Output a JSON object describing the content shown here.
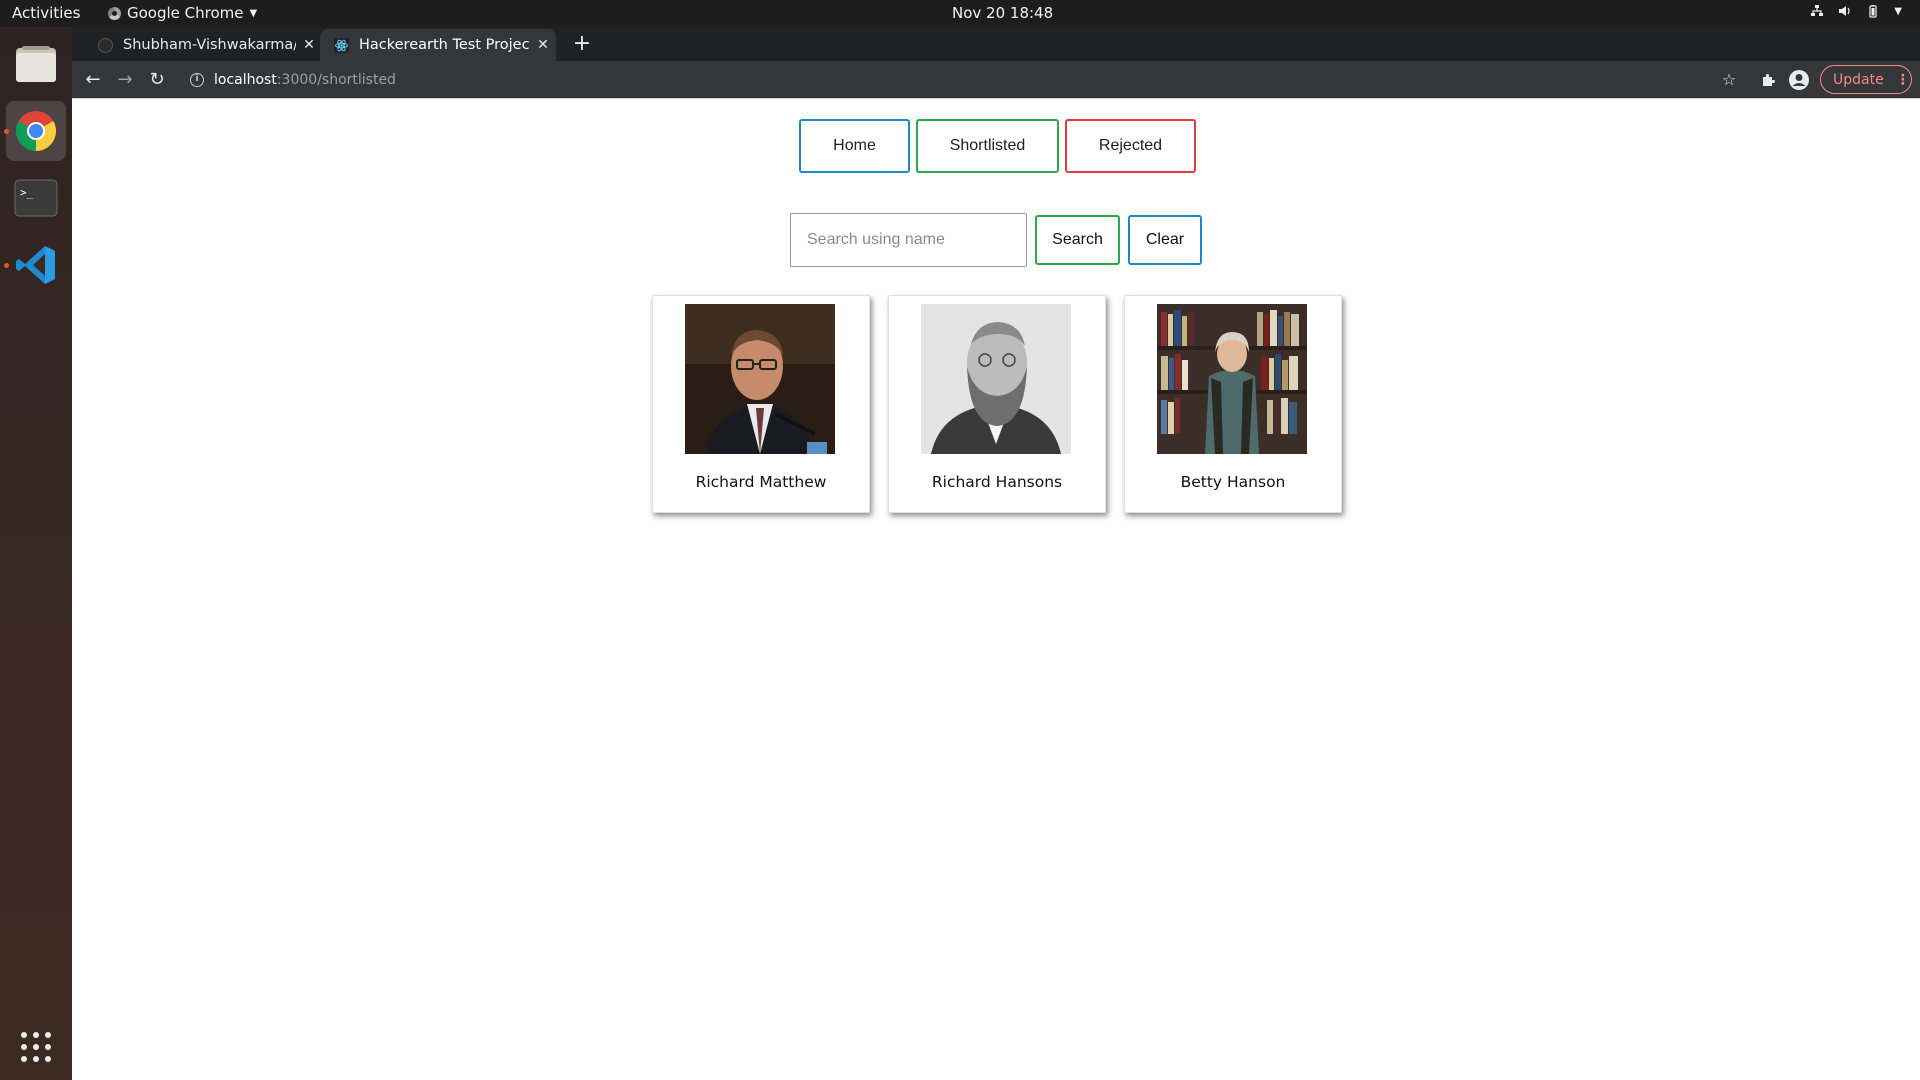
{
  "system_bar": {
    "activities": "Activities",
    "app_name": "Google Chrome",
    "clock": "Nov 20  18:48"
  },
  "dock": {
    "items": [
      "files",
      "google-chrome",
      "terminal",
      "vscode",
      "show-applications"
    ]
  },
  "browser": {
    "tabs": [
      {
        "title": "Shubham-Vishwakarma/F",
        "active": false
      },
      {
        "title": "Hackerearth Test Project",
        "active": true
      }
    ],
    "url_host": "localhost",
    "url_path": ":3000/shortlisted",
    "update_label": "Update"
  },
  "page": {
    "nav": {
      "home": "Home",
      "shortlisted": "Shortlisted",
      "rejected": "Rejected"
    },
    "search": {
      "placeholder": "Search using name",
      "value": "",
      "search_label": "Search",
      "clear_label": "Clear"
    },
    "candidates": [
      {
        "name": "Richard Matthew"
      },
      {
        "name": "Richard Hansons"
      },
      {
        "name": "Betty Hanson"
      }
    ]
  },
  "colors": {
    "blue_border": "#1e88c7",
    "green_border": "#2ba84a",
    "red_border": "#e03a3a",
    "update_accent": "#f28b82"
  }
}
